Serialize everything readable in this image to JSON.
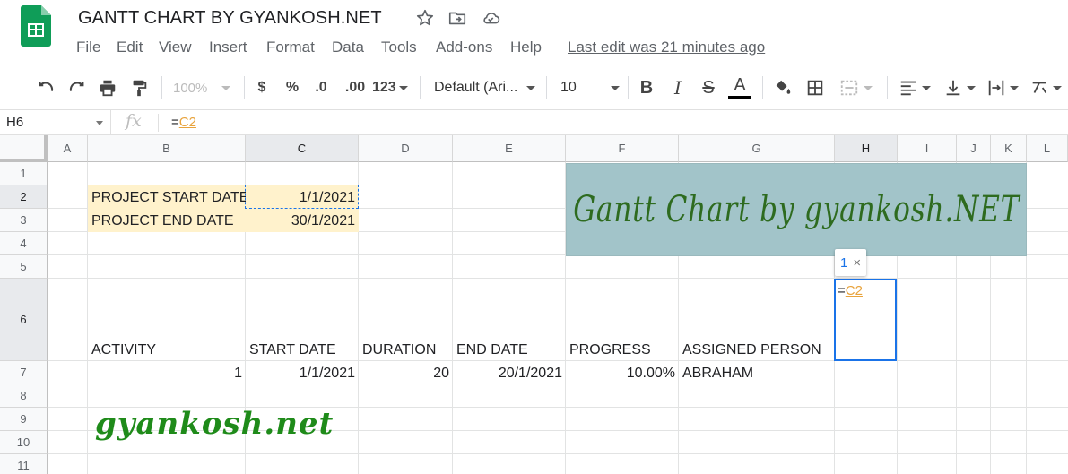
{
  "app": {
    "doc_title": "GANTT CHART BY GYANKOSH.NET",
    "last_edit": "Last edit was 21 minutes ago",
    "menu": [
      "File",
      "Edit",
      "View",
      "Insert",
      "Format",
      "Data",
      "Tools",
      "Add-ons",
      "Help"
    ]
  },
  "toolbar": {
    "zoom": "100%",
    "currency": "$",
    "percent": "%",
    "dec_decrease": ".0",
    "dec_increase": ".00",
    "more_formats": "123",
    "font": "Default (Ari...",
    "font_size": "10",
    "bold": "B",
    "italic": "I",
    "strike": "S",
    "text_color": "A"
  },
  "formula_bar": {
    "cell_ref": "H6",
    "fx": "fx",
    "formula_prefix": "=",
    "formula_ref": "C2"
  },
  "columns": [
    "A",
    "B",
    "C",
    "D",
    "E",
    "F",
    "G",
    "H",
    "I",
    "J",
    "K",
    "L"
  ],
  "rows": [
    "1",
    "2",
    "3",
    "4",
    "5",
    "6",
    "7",
    "8",
    "9",
    "10",
    "11"
  ],
  "cells": {
    "B2": "PROJECT START DATE",
    "C2": "1/1/2021",
    "B3": "PROJECT END DATE",
    "C3": "30/1/2021",
    "B6": "ACTIVITY",
    "C6": "START DATE",
    "D6": "DURATION",
    "E6": "END DATE",
    "F6": "PROGRESS",
    "G6": "ASSIGNED PERSON",
    "B7": "1",
    "C7": "1/1/2021",
    "D7": "20",
    "E7": "20/1/2021",
    "F7": "10.00%",
    "G7": "ABRAHAM"
  },
  "banner": "Gantt Chart by gyankosh.NET",
  "watermark": "gyankosh.net",
  "active_cell": {
    "prefix": "=",
    "ref": "C2"
  },
  "ref_chip": {
    "count": "1",
    "close": "×"
  },
  "colors": {
    "highlight_fill": "#fff2cc",
    "banner_bg": "#a2c4c9",
    "banner_text": "#2e6b1f",
    "watermark_text": "#1f8b1a",
    "selection_blue": "#1a73e8",
    "reference_orange": "#e8a33c",
    "sheets_green": "#0f9d58"
  }
}
